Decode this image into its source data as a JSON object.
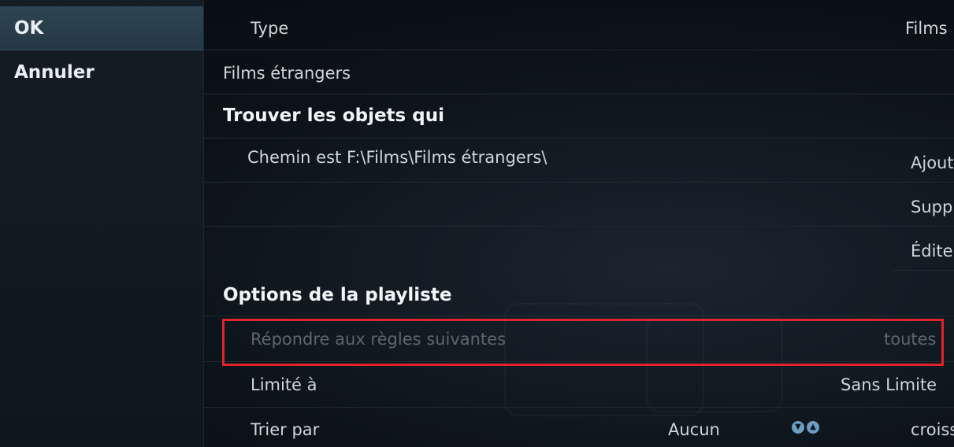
{
  "left_panel": {
    "ok_label": "OK",
    "cancel_label": "Annuler"
  },
  "rows": {
    "type": {
      "label": "Type",
      "value": "Films"
    },
    "name": {
      "value": "Films étrangers"
    },
    "rules_header": "Trouver les objets qui",
    "rule_1": "Chemin est F:\\Films\\Films étrangers\\",
    "playlist_header": "Options de la playliste",
    "match": {
      "label": "Répondre aux règles suivantes",
      "value": "toutes"
    },
    "limit": {
      "label": "Limité à",
      "value": "Sans Limite"
    },
    "sort": {
      "label": "Trier par",
      "value": "Aucun",
      "order": "croiss"
    }
  },
  "side_buttons": {
    "add": "Ajout",
    "delete": "Suppr",
    "edit": "Éditer"
  },
  "colors": {
    "highlight_border": "#e0242c",
    "focus_bg": "#2f4554",
    "arrow_icon": "#6c9ec4"
  },
  "icons": {
    "sort_up": "arrow-up-icon",
    "sort_down": "arrow-down-icon"
  }
}
